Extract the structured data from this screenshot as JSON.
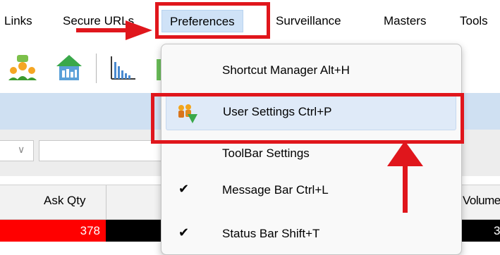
{
  "menubar": {
    "items": [
      "Links",
      "Secure URLs",
      "Preferences",
      "Surveillance",
      "Masters",
      "Tools"
    ]
  },
  "toolbar": {
    "buttons": [
      "users-tree-icon",
      "house-chart-icon",
      "bar-chart-icon",
      "partial-chart-icon"
    ]
  },
  "preferences_menu": {
    "items": [
      {
        "label": "Shortcut Manager   Alt+H",
        "checked": false,
        "icon": null
      },
      {
        "label": "User Settings   Ctrl+P",
        "checked": false,
        "icon": "user-settings-icon"
      },
      {
        "label": "ToolBar Settings",
        "checked": false,
        "icon": null
      },
      {
        "label": "Message Bar   Ctrl+L",
        "checked": true,
        "icon": null
      },
      {
        "label": "Status Bar   Shift+T",
        "checked": true,
        "icon": null
      }
    ]
  },
  "grid": {
    "columns": [
      "Ask Qty",
      "Volume"
    ],
    "rows": [
      {
        "ask_qty": "378",
        "right_value": "3"
      }
    ]
  },
  "check_glyph": "✔",
  "colors": {
    "highlight": "#e0161c",
    "menu_active": "#cfe2f7",
    "ask_cell": "#ff0000",
    "band": "#cfe0f2"
  }
}
